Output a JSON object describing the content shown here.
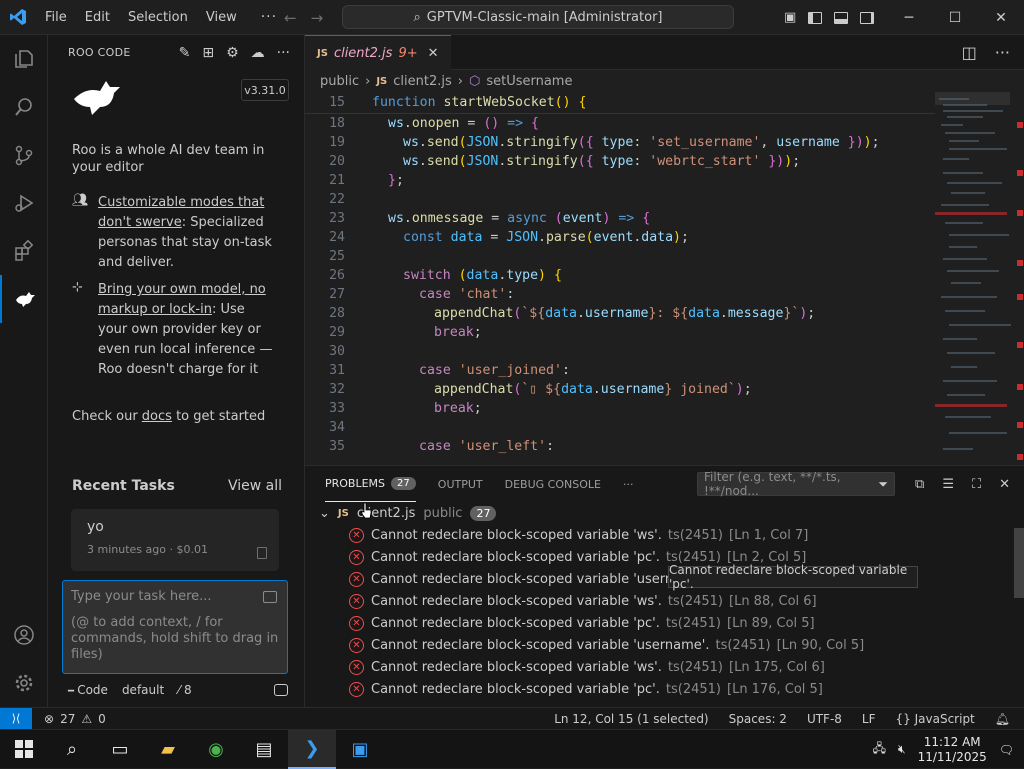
{
  "titlebar": {
    "menu": [
      "File",
      "Edit",
      "Selection",
      "View"
    ],
    "more": "···",
    "search": "GPTVM-Classic-main [Administrator]"
  },
  "roo": {
    "header": "ROO CODE",
    "version": "v3.31.0",
    "intro": "Roo is a whole AI dev team in your editor",
    "feature1_link": "Customizable modes that don't swerve",
    "feature1_text": ": Specialized personas that stay on-task and deliver.",
    "feature2_link": "Bring your own model, no markup or lock-in",
    "feature2_text": ": Use your own provider key or even run local inference — Roo doesn't charge for it",
    "docs_prefix": "Check our ",
    "docs_link": "docs",
    "docs_suffix": " to get started",
    "recent_title": "Recent Tasks",
    "view_all": "View all",
    "task_title": "yo",
    "task_meta": "3 minutes ago · $0.01",
    "input_placeholder": "Type your task here...",
    "input_hint": "(@ to add context, / for commands, hold shift to drag in files)",
    "mode": "Code",
    "profile": "default",
    "count": "8"
  },
  "editor": {
    "tab_name": "client2.js",
    "tab_count": "9+",
    "crumbs": [
      "public",
      "client2.js",
      "setUsername"
    ],
    "lines": [
      {
        "n": "15",
        "sticky": true
      },
      {
        "n": "18"
      },
      {
        "n": "19"
      },
      {
        "n": "20"
      },
      {
        "n": "21"
      },
      {
        "n": "22"
      },
      {
        "n": "23"
      },
      {
        "n": "24"
      },
      {
        "n": "25"
      },
      {
        "n": "26"
      },
      {
        "n": "27"
      },
      {
        "n": "28"
      },
      {
        "n": "29"
      },
      {
        "n": "30"
      },
      {
        "n": "31"
      },
      {
        "n": "32"
      },
      {
        "n": "33"
      },
      {
        "n": "34"
      },
      {
        "n": "35"
      }
    ]
  },
  "panel": {
    "tabs": [
      "PROBLEMS",
      "OUTPUT",
      "DEBUG CONSOLE"
    ],
    "problems_count": "27",
    "filter_placeholder": "Filter (e.g. text, **/*.ts, !**/nod...",
    "group_file": "client2.js",
    "group_dir": "public",
    "group_count": "27",
    "problems": [
      {
        "msg": "Cannot redeclare block-scoped variable 'ws'.",
        "code": "ts(2451)",
        "pos": "[Ln 1, Col 7]"
      },
      {
        "msg": "Cannot redeclare block-scoped variable 'pc'.",
        "code": "ts(2451)",
        "pos": "[Ln 2, Col 5]"
      },
      {
        "msg": "Cannot redeclare block-scoped variable 'username'.",
        "code": "",
        "pos": ""
      },
      {
        "msg": "Cannot redeclare block-scoped variable 'ws'.",
        "code": "ts(2451)",
        "pos": "[Ln 88, Col 6]"
      },
      {
        "msg": "Cannot redeclare block-scoped variable 'pc'.",
        "code": "ts(2451)",
        "pos": "[Ln 89, Col 5]"
      },
      {
        "msg": "Cannot redeclare block-scoped variable 'username'.",
        "code": "ts(2451)",
        "pos": "[Ln 90, Col 5]"
      },
      {
        "msg": "Cannot redeclare block-scoped variable 'ws'.",
        "code": "ts(2451)",
        "pos": "[Ln 175, Col 6]"
      },
      {
        "msg": "Cannot redeclare block-scoped variable 'pc'.",
        "code": "ts(2451)",
        "pos": "[Ln 176, Col 5]"
      }
    ],
    "tooltip": "Cannot redeclare block-scoped variable 'pc'."
  },
  "status": {
    "errors": "27",
    "warnings": "0",
    "position": "Ln 12, Col 15 (1 selected)",
    "spaces": "Spaces: 2",
    "encoding": "UTF-8",
    "eol": "LF",
    "language": "JavaScript"
  },
  "taskbar": {
    "time": "11:12 AM",
    "date": "11/11/2025"
  },
  "colors": {
    "accent": "#0078d4",
    "error": "#f14c4c"
  }
}
